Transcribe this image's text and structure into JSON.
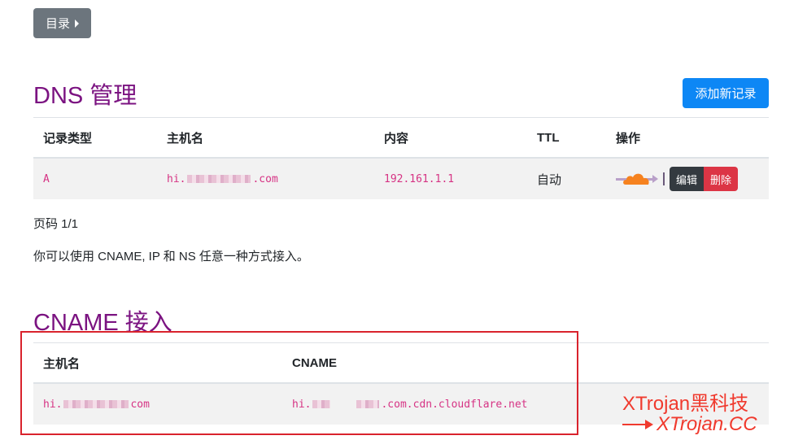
{
  "toc": {
    "label": "目录"
  },
  "dns": {
    "title": "DNS 管理",
    "add_button": "添加新记录",
    "columns": [
      "记录类型",
      "主机名",
      "内容",
      "TTL",
      "操作"
    ],
    "rows": [
      {
        "type": "A",
        "host_prefix": "hi.",
        "host_suffix": ".com",
        "content": "192.161.1.1",
        "ttl": "自动",
        "edit_label": "编辑",
        "delete_label": "删除"
      }
    ]
  },
  "pagination": {
    "text": "页码 1/1"
  },
  "info": {
    "text": "你可以使用 CNAME, IP 和 NS 任意一种方式接入。"
  },
  "cname": {
    "title": "CNAME 接入",
    "columns": [
      "主机名",
      "CNAME"
    ],
    "rows": [
      {
        "host_prefix": "hi.",
        "host_suffix": "com",
        "cname_prefix": "hi.",
        "cname_suffix": ".com.cdn.cloudflare.net"
      }
    ]
  },
  "watermark": {
    "line1": "XTrojan黑科技",
    "line2": "XTrojan.CC"
  },
  "colors": {
    "heading": "#7b1381",
    "primary": "#0d87f5",
    "danger": "#dc3545",
    "code": "#d63384",
    "cloud": "#f6821f",
    "highlight": "#d9232d"
  }
}
